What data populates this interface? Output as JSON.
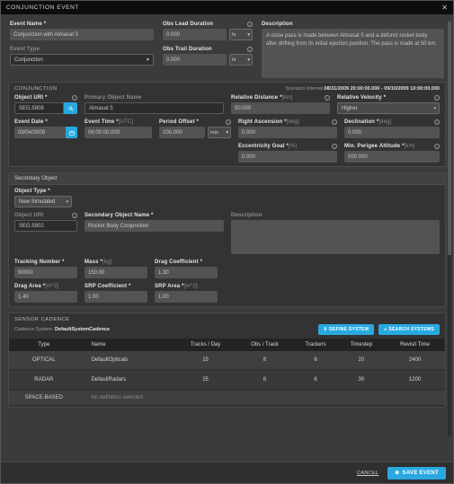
{
  "window": {
    "title": "CONJUNCTION EVENT",
    "close": "✕"
  },
  "top": {
    "event_name": {
      "label": "Event Name",
      "required": "*",
      "value": "Conjunction with Almasat 5"
    },
    "event_type": {
      "label": "Event Type",
      "value": "Conjunction"
    },
    "obs_lead": {
      "label": "Obs Lead Duration",
      "value": "0.000",
      "unit": "hr"
    },
    "obs_trail": {
      "label": "Obs Trail Duration",
      "value": "0.000",
      "unit": "hr"
    },
    "description": {
      "label": "Description",
      "value": "A close pass is made between Almasat 5 and a defunct rocket body after drifting from its initial ejection position. The pass is made at 50 km."
    }
  },
  "conjunction": {
    "section_title": "CONJUNCTION",
    "scenario_interval_label": "Scenario Interval",
    "scenario_interval_value": "08/31/2009 20:00:00.000 - 09/10/2009 10:00:00.000",
    "object_uri": {
      "label": "Object URI",
      "required": "*",
      "value": "SEG.5908"
    },
    "primary_object_name": {
      "label": "Primary Object Name",
      "value": "Almasat 5"
    },
    "event_date": {
      "label": "Event Date",
      "required": "*",
      "value": "09/04/2009"
    },
    "event_time": {
      "label": "Event Time",
      "required": "*",
      "unit": "[UTC]",
      "value": "06:00:00.000"
    },
    "period_offset": {
      "label": "Period Offset",
      "required": "*",
      "value": "100.000",
      "unit": "min"
    },
    "relative_distance": {
      "label": "Relative Distance",
      "required": "*",
      "unit": "[km]",
      "value": "50.000"
    },
    "relative_velocity": {
      "label": "Relative Velocity",
      "required": "*",
      "value": "Higher"
    },
    "right_ascension": {
      "label": "Right Ascension",
      "required": "*",
      "unit": "[deg]",
      "value": "0.000"
    },
    "declination": {
      "label": "Declination",
      "required": "*",
      "unit": "[deg]",
      "value": "0.000"
    },
    "eccentricity_goal": {
      "label": "Eccentricity Goal",
      "required": "*",
      "unit": "[%]",
      "value": "0.000"
    },
    "min_perigee_altitude": {
      "label": "Min. Perigee Altitude",
      "required": "*",
      "unit": "[km]",
      "value": "500.000"
    }
  },
  "secondary": {
    "section_title": "Secondary Object",
    "object_type": {
      "label": "Object Type",
      "required": "*",
      "value": "New Simulated"
    },
    "object_uri": {
      "label": "Object URI",
      "value": "SEG.5902"
    },
    "object_name": {
      "label": "Secondary Object Name",
      "required": "*",
      "value": "Rocket Body Conjunction"
    },
    "description": {
      "label": "Description",
      "value": ""
    },
    "tracking_number": {
      "label": "Tracking Number",
      "required": "*",
      "value": "90000"
    },
    "mass": {
      "label": "Mass",
      "required": "*",
      "unit": "[kg]",
      "value": "150.00"
    },
    "drag_coefficient": {
      "label": "Drag Coefficient",
      "required": "*",
      "value": "1.30"
    },
    "drag_area": {
      "label": "Drag Area",
      "required": "*",
      "unit": "[m^2]",
      "value": "1.40"
    },
    "srp_coefficient": {
      "label": "SRP Coefficient",
      "required": "*",
      "value": "1.00"
    },
    "srp_area": {
      "label": "SRP Area",
      "required": "*",
      "unit": "[m^2]",
      "value": "1.00"
    }
  },
  "sensor_cadence": {
    "section_title": "SENSOR CADENCE",
    "cadence_system_label": "Cadence System:",
    "cadence_system_value": "DefaultSystemCadence",
    "define_system_button": "DEFINE SYSTEM",
    "search_systems_button": "SEARCH SYSTEMS",
    "columns": [
      "Type",
      "Name",
      "Tracks / Day",
      "Obs / Track",
      "Trackers",
      "Timestep",
      "Revisit Time"
    ],
    "rows": [
      {
        "type": "OPTICAL",
        "name": "DefaultOpticals",
        "tracks_day": "15",
        "obs_track": "8",
        "trackers": "6",
        "timestep": "20",
        "revisit": "2400",
        "muted": false
      },
      {
        "type": "RADAR",
        "name": "DefaultRadars",
        "tracks_day": "25",
        "obs_track": "8",
        "trackers": "6",
        "timestep": "30",
        "revisit": "1200",
        "muted": false
      },
      {
        "type": "SPACE-BASED",
        "name": "No definition selected",
        "tracks_day": "",
        "obs_track": "",
        "trackers": "",
        "timestep": "",
        "revisit": "",
        "muted": true
      }
    ]
  },
  "footer": {
    "cancel": "CANCEL",
    "save": "SAVE EVENT"
  },
  "colors": {
    "accent": "#29a8e0",
    "panel": "#333333",
    "field": "#535353"
  }
}
